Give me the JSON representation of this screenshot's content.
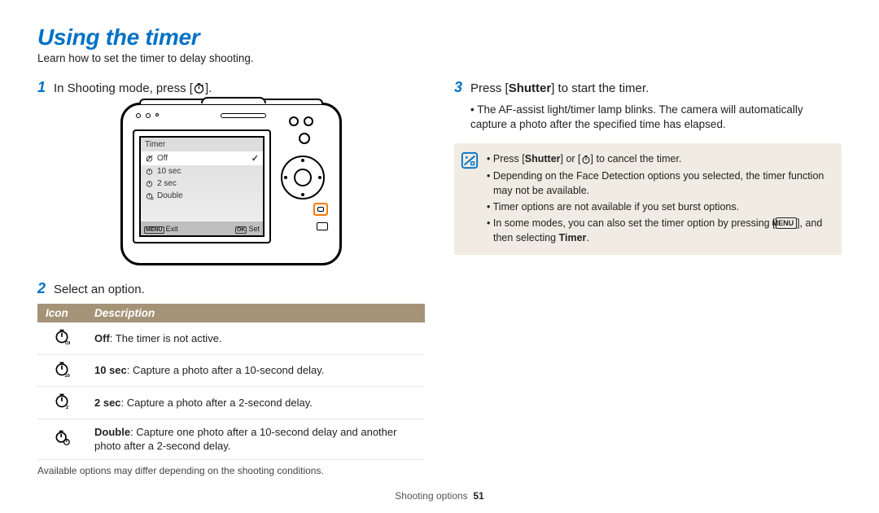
{
  "page_title": "Using the timer",
  "intro": "Learn how to set the timer to delay shooting.",
  "steps": {
    "s1": {
      "num": "1",
      "pre": "In Shooting mode, press [",
      "post": "]."
    },
    "s2": {
      "num": "2",
      "text": "Select an option."
    },
    "s3": {
      "num": "3",
      "pre": "Press [",
      "btn": "Shutter",
      "post": "] to start the timer."
    }
  },
  "camera_menu": {
    "title": "Timer",
    "items": [
      {
        "label": "Off",
        "selected": true
      },
      {
        "label": "10 sec",
        "selected": false
      },
      {
        "label": "2 sec",
        "selected": false
      },
      {
        "label": "Double",
        "selected": false
      }
    ],
    "exit": "Exit",
    "set": "Set",
    "exit_key": "MENU",
    "set_key": "OK"
  },
  "table": {
    "headers": {
      "icon": "Icon",
      "desc": "Description"
    },
    "rows": [
      {
        "name": "Off",
        "desc": ": The timer is not active."
      },
      {
        "name": "10 sec",
        "desc": ": Capture a photo after a 10-second delay."
      },
      {
        "name": "2 sec",
        "desc": ": Capture a photo after a 2-second delay."
      },
      {
        "name": "Double",
        "desc": ": Capture one photo after a 10-second delay and another photo after a 2-second delay."
      }
    ]
  },
  "table_note": "Available options may differ depending on the shooting conditions.",
  "step3_detail": "The AF-assist light/timer lamp blinks. The camera will automatically capture a photo after the specified time has elapsed.",
  "info": {
    "b1_pre": "Press [",
    "b1_btn": "Shutter",
    "b1_mid": "] or [",
    "b1_post": "] to cancel the timer.",
    "b2": "Depending on the Face Detection options you selected, the timer function may not be available.",
    "b3": "Timer options are not available if you set burst options.",
    "b4_pre": "In some modes, you can also set the timer option by pressing [",
    "b4_menu": "MENU",
    "b4_mid": "], and then selecting ",
    "b4_timer": "Timer",
    "b4_post": "."
  },
  "footer": {
    "section": "Shooting options",
    "page": "51"
  }
}
